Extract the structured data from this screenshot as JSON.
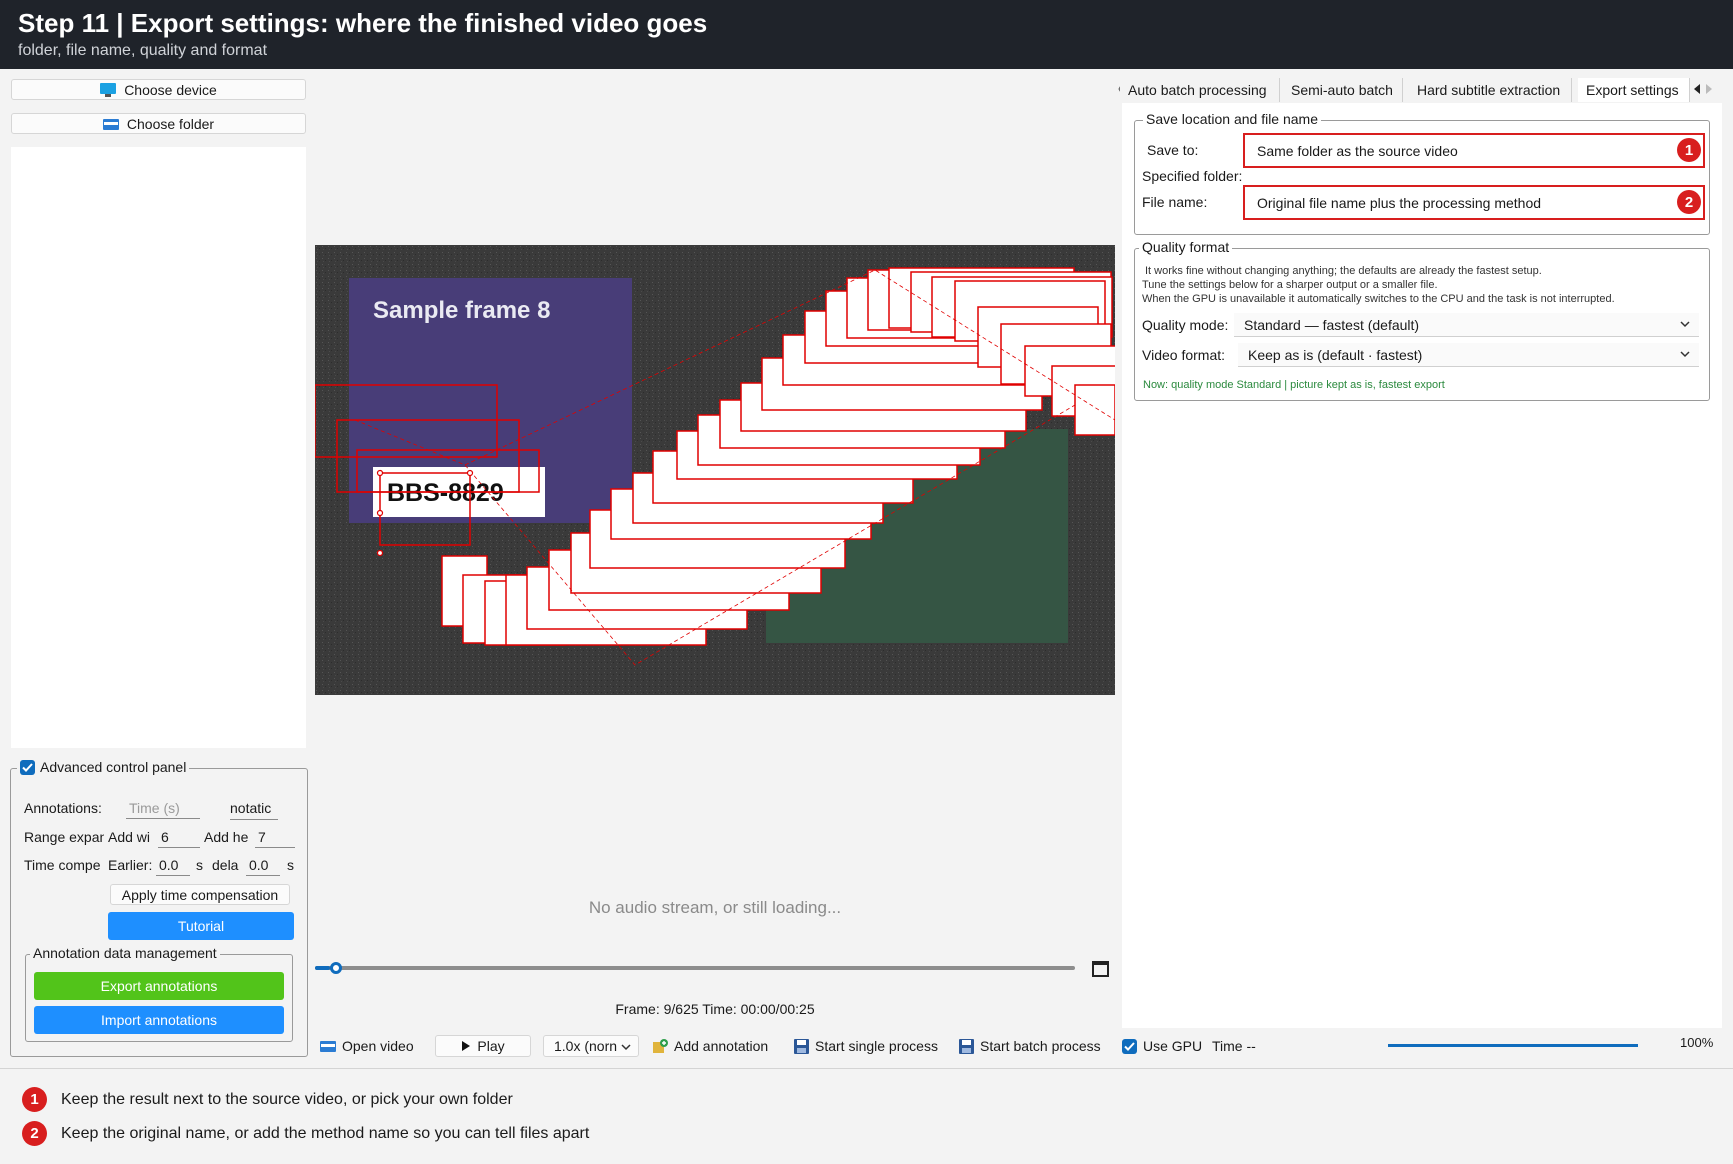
{
  "header": {
    "title": "Step 11  |  Export settings: where the finished video goes",
    "subtitle": "folder, file name, quality and format"
  },
  "left": {
    "choose_device": "Choose device",
    "choose_folder": "Choose folder",
    "advanced": {
      "title": "Advanced control panel",
      "annotations_label": "Annotations:",
      "time_placeholder": "Time (s)",
      "annotation_value": "notatic",
      "range_label": "Range expan",
      "add_width_label": "Add wi",
      "add_width_value": "6",
      "add_height_label": "Add he",
      "add_height_value": "7",
      "time_comp_label": "Time compe",
      "earlier_label": "Earlier:",
      "earlier_value": "0.0",
      "earlier_unit": "s",
      "delay_label": "dela",
      "delay_value": "0.0",
      "delay_unit": "s",
      "apply_button": "Apply time compensation",
      "tutorial_button": "Tutorial"
    },
    "data_mgmt": {
      "title": "Annotation data management",
      "export_button": "Export annotations",
      "import_button": "Import annotations"
    }
  },
  "center": {
    "frame_title": "Sample frame 8",
    "plate_text": "BBS-8829",
    "audio_message": "No audio stream, or still loading...",
    "frame_status": "Frame: 9/625  Time: 00:00/00:25",
    "timeline_progress": 0.02
  },
  "right": {
    "tabs": [
      "Auto batch processing",
      "Semi-auto batch",
      "Hard subtitle extraction",
      "Export settings"
    ],
    "active_tab": "Export settings",
    "save_group": {
      "title": "Save location and file name",
      "save_to_label": "Save to:",
      "save_to_value": "Same folder as the source video",
      "specified_label": "Specified folder:",
      "file_name_label": "File name:",
      "file_name_value": "Original file name plus the processing method"
    },
    "quality_group": {
      "title": "Quality  format",
      "note_line1": "It works fine without changing anything; the defaults are already the fastest setup.",
      "note_line2": "Tune the settings below for a sharper output or a smaller file.",
      "note_line3": "When the GPU is unavailable it automatically switches to the CPU and the task is not interrupted.",
      "quality_label": "Quality mode:",
      "quality_value": "Standard — fastest (default)",
      "format_label": "Video format:",
      "format_value": "Keep as is (default · fastest)",
      "status": "Now: quality mode Standard | picture kept as is, fastest export"
    }
  },
  "toolbar": {
    "open_video": "Open video",
    "play": "Play",
    "speed": "1.0x (norn",
    "add_annotation": "Add annotation",
    "start_single": "Start single process",
    "start_batch": "Start batch process",
    "use_gpu": "Use GPU",
    "time": "Time --",
    "progress_text": "100%",
    "progress_value": 1.0
  },
  "badges": [
    "1",
    "2"
  ],
  "footnotes": [
    "Keep the result next to the source video, or pick your own folder",
    "Keep the original name, or add the method name so you can tell files apart"
  ],
  "colors": {
    "header_bg": "#1f232a",
    "accent_blue": "#1e8fff",
    "accent_green": "#52c41a",
    "callout_red": "#d81e1e",
    "status_green": "#2b8a3e"
  }
}
